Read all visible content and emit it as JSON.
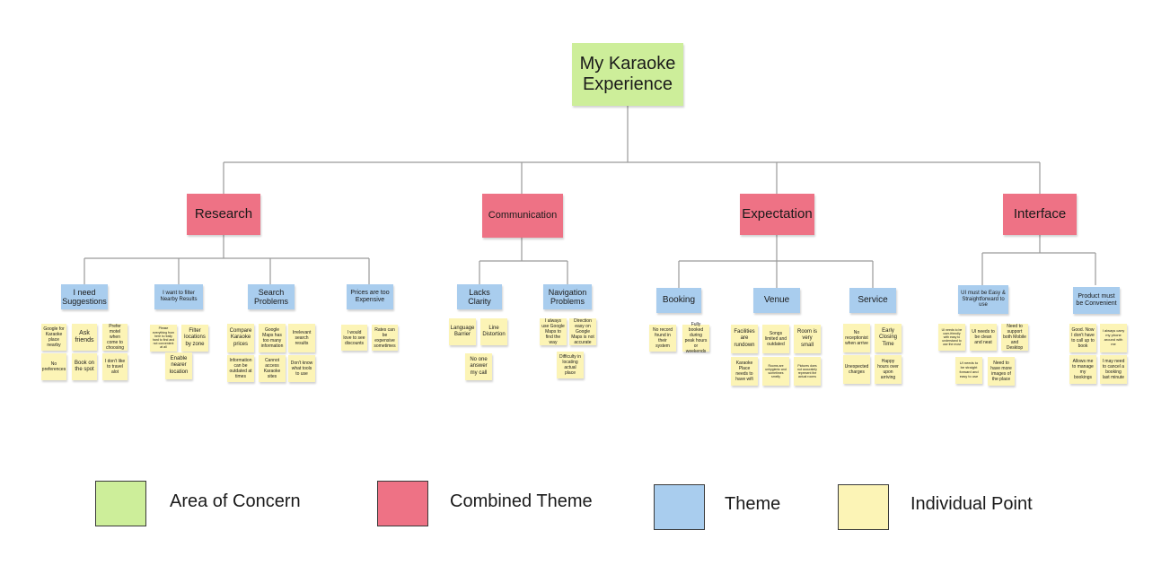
{
  "diagram": {
    "root": "My Karaoke Experience",
    "combined_themes": [
      "Research",
      "Communication",
      "Expectation",
      "Interface"
    ],
    "themes": {
      "research": [
        "I need Suggestions",
        "I want to filter Nearby Results",
        "Search Problems",
        "Prices are too Expensive"
      ],
      "communication": [
        "Lacks Clarity",
        "Navigation Problems"
      ],
      "expectation": [
        "Booking",
        "Venue",
        "Service"
      ],
      "interface": [
        "UI must be Easy & Straightforward to use",
        "Product must be Convenient"
      ]
    },
    "points": {
      "suggestions": [
        "Google for Karaoke place nearby",
        "Ask friends",
        "Prefer motel when come to choosing",
        "No preferences",
        "Book on the spot",
        "I don't like to travel alot"
      ],
      "filter": [
        "Please everything from here is really hard to find and not convenient at all",
        "Filter locations by zone",
        "Enable nearer location"
      ],
      "search": [
        "Compare Karaoke prices",
        "Google Maps has too many information",
        "Irrelevant search results",
        "Information can be outdated at times",
        "Cannot access Karaoke sites",
        "Don't know what tools to use"
      ],
      "prices": [
        "I would love to see discounts",
        "Rates can be expensive sometimes"
      ],
      "clarity": [
        "Language Barrier",
        "Line Distortion",
        "No one answer my call"
      ],
      "navigation": [
        "I always use Google Maps to find the way",
        "Direction easy on Google Maps is not accurate",
        "Difficulty in locating actual place"
      ],
      "booking": [
        "No record found in their system",
        "Fully booked during peak hours or weekends"
      ],
      "venue": [
        "Facilities are rundown",
        "Songs limited and outdated",
        "Room is very small",
        "Karaoke Place needs to have wifi",
        "Rooms are unhygienic and sometimes smelly",
        "Pictures does not accurately represent the actual rooms"
      ],
      "service": [
        "No receptionist when arrive",
        "Early Closing Time",
        "Unexpected charges",
        "Happy hours over upon arriving"
      ],
      "ui": [
        "UI needs to be user-friendly with easy to understand to use the most",
        "UI needs to be clean and neat",
        "Need to support both Mobile and Desktop",
        "UI needs to be straight forward and easy to use",
        "Need to have more images of the place"
      ],
      "convenient": [
        "Good. Now I don't have to call up to book",
        "I always carry my phone around with me",
        "Allows me to manage my bookings",
        "I may need to cancel a booking last minute"
      ]
    }
  },
  "legend": {
    "items": [
      {
        "label": "Area of Concern",
        "color": "#cdee9a"
      },
      {
        "label": "Combined Theme",
        "color": "#ee7285"
      },
      {
        "label": "Theme",
        "color": "#a9cdee"
      },
      {
        "label": "Individual Point",
        "color": "#fcf4b6"
      }
    ]
  },
  "colors": {
    "area": "#cdee9a",
    "combined": "#ee7285",
    "theme": "#a9cdee",
    "point": "#fcf4b6",
    "line": "#9a9a9a"
  }
}
